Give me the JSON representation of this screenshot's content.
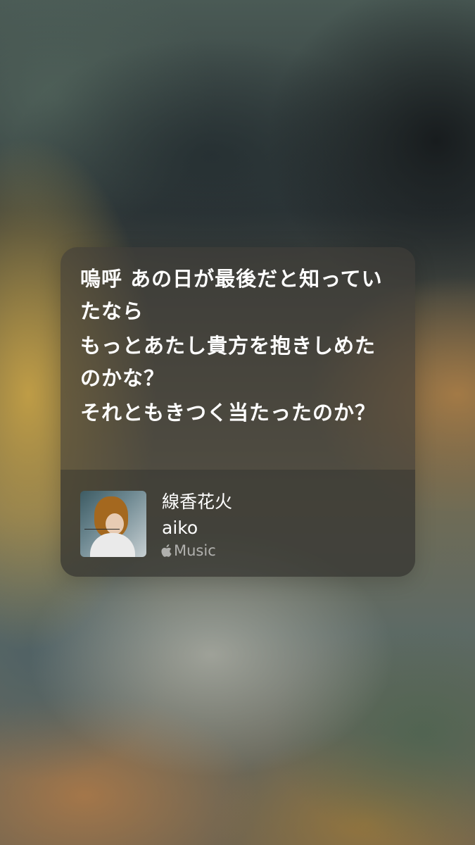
{
  "lyrics": {
    "lines": [
      "嗚呼 あの日が最後だと知っていたなら",
      "もっとあたし貴方を抱きしめたのかな？",
      "それともきつく当たったのか？"
    ]
  },
  "track": {
    "title": "線香花火",
    "artist": "aiko",
    "service_label": "Music",
    "album_art_icon": "album-art"
  },
  "colors": {
    "text": "#ffffff",
    "service_text": "rgba(255,255,255,0.58)"
  }
}
